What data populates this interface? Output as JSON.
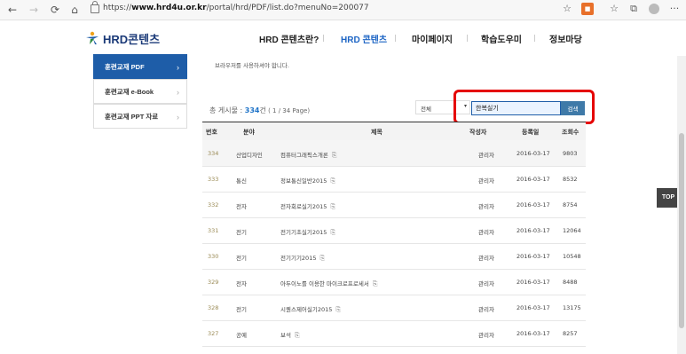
{
  "browser": {
    "url_prefix": "https://",
    "url_host": "www.hrd4u.or.kr",
    "url_path": "/portal/hrd/PDF/list.do?menuNo=200077",
    "back": "←",
    "forward": "→",
    "refresh": "⟳",
    "home": "⌂",
    "star": "☆",
    "ext": "■",
    "collections": "⧉",
    "favorites": "☆",
    "more": "···"
  },
  "header": {
    "logo_text": "HRD콘텐츠",
    "nav": [
      "HRD 콘텐츠란?",
      "HRD 콘텐츠",
      "마이페이지",
      "학습도우미",
      "정보마당"
    ],
    "active_index": 1,
    "accent": "#1c64c4"
  },
  "sidebar": {
    "items": [
      {
        "label": "훈련교재 PDF",
        "active": true
      },
      {
        "label": "훈련교재 e-Book",
        "active": false
      },
      {
        "label": "훈련교재 PPT 자료",
        "active": false
      }
    ],
    "arrow": "›"
  },
  "notice": "브라우저를 사용하셔야 합니다.",
  "list": {
    "total_label": "총 게시물 : ",
    "total_count": "334",
    "total_unit": "건",
    "page_info": " ( 1 / 34 Page)",
    "filter_selected": "전체",
    "search_value": "한복실기",
    "search_button": "검색"
  },
  "table": {
    "headers": [
      "번호",
      "분야",
      "제목",
      "작성자",
      "등록일",
      "조회수"
    ],
    "rows": [
      {
        "no": "334",
        "field": "산업디자인",
        "title": "컴퓨터그래픽스개론",
        "author": "관리자",
        "date": "2016-03-17",
        "views": "9803"
      },
      {
        "no": "333",
        "field": "통신",
        "title": "정보통신일반2015",
        "author": "관리자",
        "date": "2016-03-17",
        "views": "8532"
      },
      {
        "no": "332",
        "field": "전자",
        "title": "전자회로실기2015",
        "author": "관리자",
        "date": "2016-03-17",
        "views": "8754"
      },
      {
        "no": "331",
        "field": "전기",
        "title": "전기기초실기2015",
        "author": "관리자",
        "date": "2016-03-17",
        "views": "12064"
      },
      {
        "no": "330",
        "field": "전기",
        "title": "전기기기2015",
        "author": "관리자",
        "date": "2016-03-17",
        "views": "10548"
      },
      {
        "no": "329",
        "field": "전자",
        "title": "아두이노를 이용한 마이크로프로세서",
        "author": "관리자",
        "date": "2016-03-17",
        "views": "8488"
      },
      {
        "no": "328",
        "field": "전기",
        "title": "시퀀스제어실기2015",
        "author": "관리자",
        "date": "2016-03-17",
        "views": "13175"
      },
      {
        "no": "327",
        "field": "공예",
        "title": "보석",
        "author": "관리자",
        "date": "2016-03-17",
        "views": "8257"
      }
    ]
  },
  "top_button": "TOP",
  "colors": {
    "highlight": "#e50000",
    "sidebar_active": "#1e5da8",
    "search_button": "#3f7aa8"
  }
}
